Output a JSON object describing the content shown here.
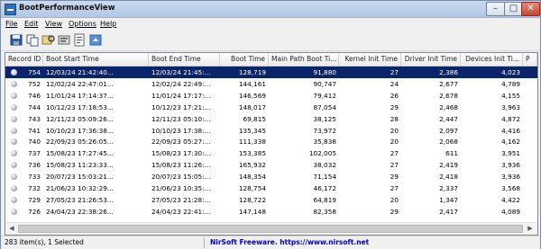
{
  "window": {
    "title": "BootPerformanceView"
  },
  "menu": [
    "File",
    "Edit",
    "View",
    "Options",
    "Help"
  ],
  "toolbar": [
    "save-icon",
    "copy-icon",
    "find-icon",
    "properties-icon",
    "report-icon",
    "refresh-icon"
  ],
  "columns": [
    "Record ID",
    "Boot Start Time",
    "Boot End Time",
    "Boot Time",
    "Main Path Boot Ti...",
    "Kernel Init Time",
    "Driver Init Time",
    "Devices Init Ti...",
    "P"
  ],
  "rows": [
    {
      "id": "754",
      "start": "12/03/24 21:42:40...",
      "end": "12/03/24 21:45:...",
      "boot": "128,719",
      "main": "91,880",
      "kernel": "27",
      "driver": "2,386",
      "devices": "4,023",
      "selected": true
    },
    {
      "id": "752",
      "start": "12/02/24 22:47:01...",
      "end": "12/02/24 22:49:...",
      "boot": "144,161",
      "main": "90,747",
      "kernel": "24",
      "driver": "2,677",
      "devices": "4,789",
      "selected": false
    },
    {
      "id": "746",
      "start": "11/01/24 17:14:37...",
      "end": "11/01/24 17:17:...",
      "boot": "146,569",
      "main": "79,412",
      "kernel": "26",
      "driver": "2,678",
      "devices": "4,155",
      "selected": false
    },
    {
      "id": "744",
      "start": "10/12/23 17:18:53...",
      "end": "10/12/23 17:21:...",
      "boot": "148,017",
      "main": "87,054",
      "kernel": "29",
      "driver": "2,468",
      "devices": "3,963",
      "selected": false
    },
    {
      "id": "743",
      "start": "12/11/23 05:09:26...",
      "end": "12/11/23 05:10:...",
      "boot": "69,815",
      "main": "38,125",
      "kernel": "28",
      "driver": "2,447",
      "devices": "4,872",
      "selected": false
    },
    {
      "id": "741",
      "start": "10/10/23 17:36:38...",
      "end": "10/10/23 17:38:...",
      "boot": "135,345",
      "main": "73,972",
      "kernel": "20",
      "driver": "2,097",
      "devices": "4,416",
      "selected": false
    },
    {
      "id": "740",
      "start": "22/09/23 05:26:05...",
      "end": "22/09/23 05:27:...",
      "boot": "111,338",
      "main": "35,838",
      "kernel": "20",
      "driver": "2,068",
      "devices": "4,162",
      "selected": false
    },
    {
      "id": "737",
      "start": "15/08/23 17:27:45...",
      "end": "15/08/23 17:30:...",
      "boot": "153,385",
      "main": "102,005",
      "kernel": "27",
      "driver": "611",
      "devices": "3,951",
      "selected": false
    },
    {
      "id": "736",
      "start": "15/08/23 11:23:33...",
      "end": "15/08/23 11:26:...",
      "boot": "165,932",
      "main": "38,032",
      "kernel": "27",
      "driver": "2,419",
      "devices": "3,936",
      "selected": false
    },
    {
      "id": "733",
      "start": "20/07/23 15:03:21...",
      "end": "20/07/23 15:05:...",
      "boot": "148,354",
      "main": "71,154",
      "kernel": "29",
      "driver": "2,418",
      "devices": "3,936",
      "selected": false
    },
    {
      "id": "732",
      "start": "21/06/23 10:32:29...",
      "end": "21/06/23 10:35:...",
      "boot": "128,754",
      "main": "46,172",
      "kernel": "27",
      "driver": "2,337",
      "devices": "3,568",
      "selected": false
    },
    {
      "id": "729",
      "start": "27/05/23 21:26:53...",
      "end": "27/05/23 21:28:...",
      "boot": "128,722",
      "main": "64,819",
      "kernel": "20",
      "driver": "1,347",
      "devices": "4,422",
      "selected": false
    },
    {
      "id": "726",
      "start": "24/04/23 22:38:26...",
      "end": "24/04/23 22:41:...",
      "boot": "147,148",
      "main": "82,358",
      "kernel": "29",
      "driver": "2,417",
      "devices": "4,089",
      "selected": false
    }
  ],
  "status": {
    "left": "283 item(s), 1 Selected",
    "link": "NirSoft Freeware. https://www.nirsoft.net"
  }
}
